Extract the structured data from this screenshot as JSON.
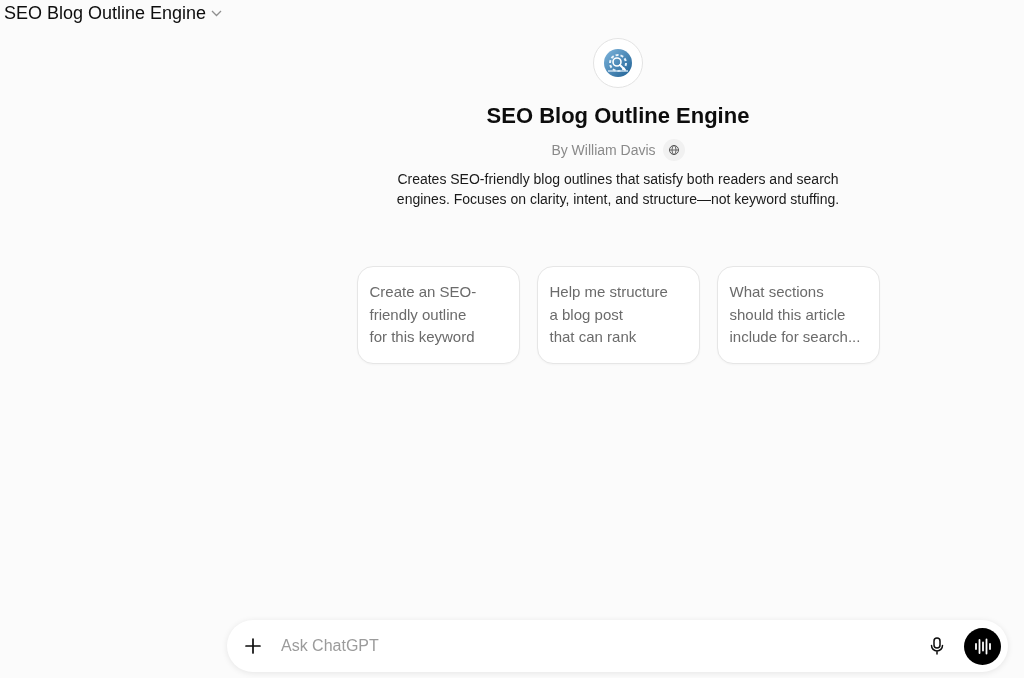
{
  "header": {
    "title": "SEO Blog Outline Engine"
  },
  "profile": {
    "name": "SEO Blog Outline Engine",
    "author": "By William Davis",
    "description": "Creates SEO-friendly blog outlines that satisfy both readers and search engines. Focuses on clarity, intent, and structure—not keyword stuffing."
  },
  "suggestions": [
    {
      "lines": [
        "Create an SEO-",
        "friendly outline",
        "for this keyword"
      ]
    },
    {
      "lines": [
        "Help me structure",
        "a blog post",
        "that can rank"
      ]
    },
    {
      "lines": [
        "What sections",
        "should this article",
        "include for search..."
      ]
    }
  ],
  "composer": {
    "placeholder": "Ask ChatGPT"
  }
}
